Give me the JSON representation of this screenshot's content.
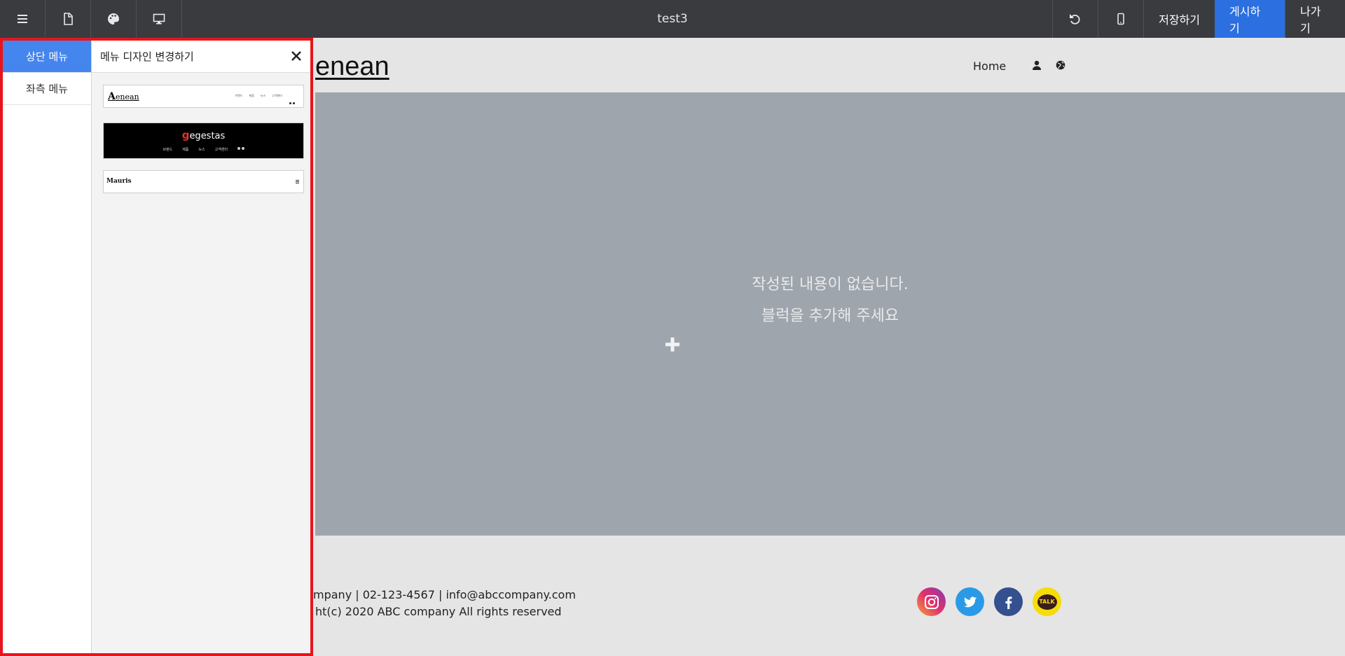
{
  "toolbar": {
    "title": "test3",
    "save_label": "저장하기",
    "publish_label": "게시하기",
    "exit_label": "나가기",
    "icons": [
      "menu-icon",
      "page-icon",
      "palette-icon",
      "desktop-icon",
      "undo-icon",
      "mobile-icon"
    ]
  },
  "panel": {
    "tabs": [
      {
        "label": "상단 메뉴",
        "active": true
      },
      {
        "label": "좌측 메뉴",
        "active": false
      }
    ],
    "heading": "메뉴 디자인 변경하기",
    "designs": [
      {
        "logo_initial": "A",
        "logo_rest": "enean",
        "menu": [
          "브랜드",
          "제품",
          "뉴스",
          "고객센터"
        ]
      },
      {
        "logo_mark": "g",
        "logo_rest": "egestas",
        "menu": [
          "브랜드",
          "제품",
          "뉴스",
          "고객센터"
        ]
      },
      {
        "logo": "Mauris"
      }
    ]
  },
  "site": {
    "logo": "enean",
    "nav": {
      "home": "Home"
    },
    "empty": {
      "line1": "작성된 내용이 없습니다.",
      "line2": "블럭을 추가해 주세요"
    },
    "footer": {
      "line1": "mpany | 02-123-4567 | info@abccompany.com",
      "line2": "ht(c) 2020 ABC company All rights reserved",
      "kakao_label": "TALK"
    }
  },
  "colors": {
    "toolbar_bg": "#3a3b3f",
    "publish_bg": "#2b6fe0",
    "active_tab": "#4485ee",
    "panel_border": "#e8141b",
    "empty_block": "#9fa5ac"
  }
}
